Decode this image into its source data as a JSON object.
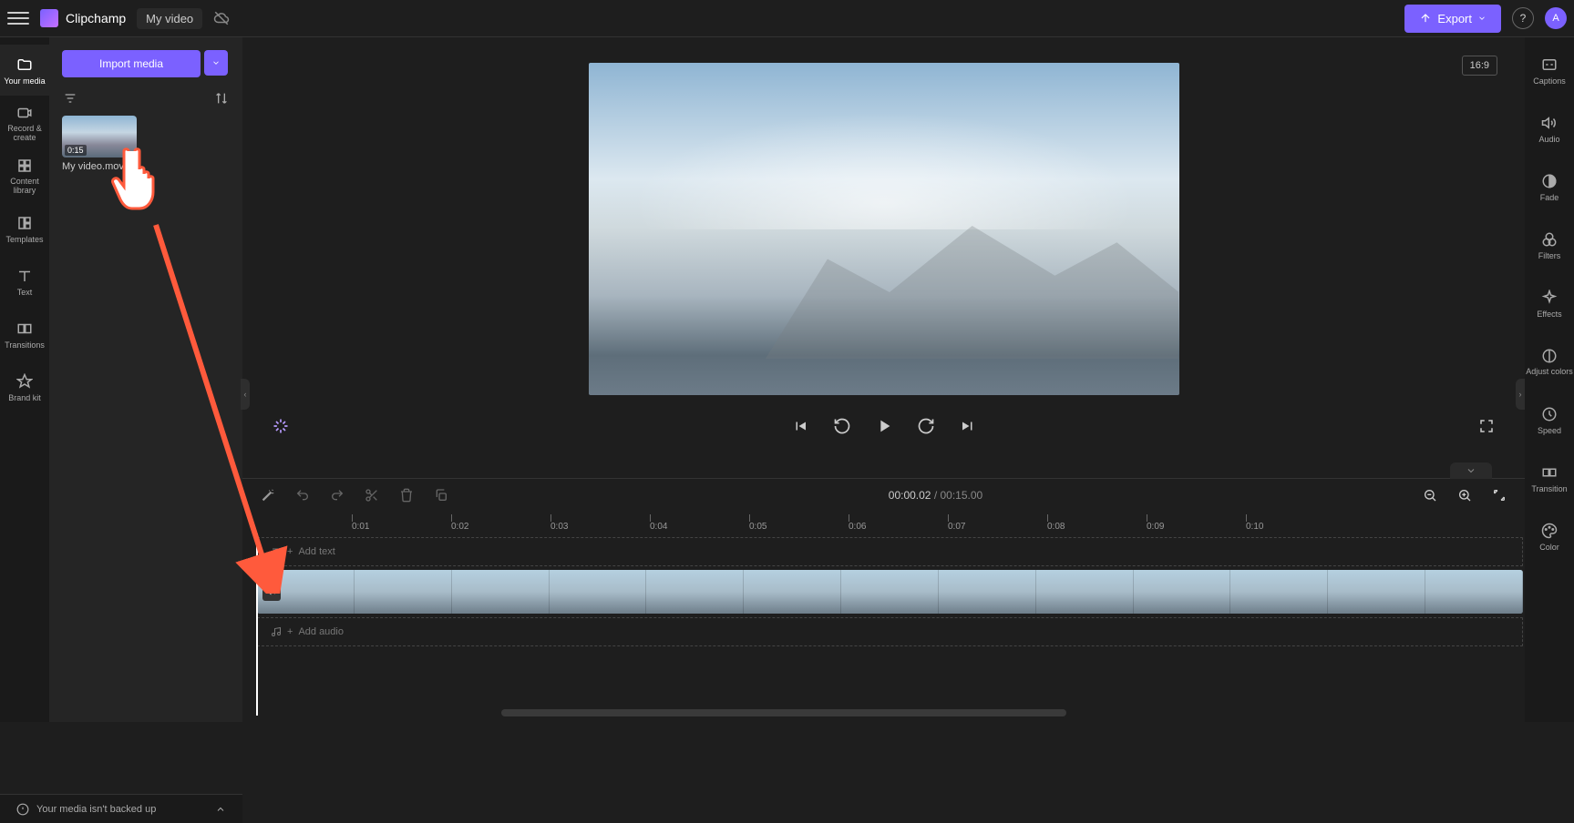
{
  "header": {
    "app_name": "Clipchamp",
    "video_title": "My video",
    "export_label": "Export",
    "avatar_letter": "A"
  },
  "left_nav": {
    "items": [
      {
        "label": "Your media",
        "icon": "folder"
      },
      {
        "label": "Record & create",
        "icon": "camera"
      },
      {
        "label": "Content library",
        "icon": "library"
      },
      {
        "label": "Templates",
        "icon": "templates"
      },
      {
        "label": "Text",
        "icon": "text"
      },
      {
        "label": "Transitions",
        "icon": "transitions"
      },
      {
        "label": "Brand kit",
        "icon": "brand"
      }
    ]
  },
  "media_panel": {
    "import_label": "Import media",
    "items": [
      {
        "duration": "0:15",
        "name": "My video.mov"
      }
    ]
  },
  "preview": {
    "aspect": "16:9",
    "current_time": "00:00.02",
    "duration": "00:15.00"
  },
  "right_nav": {
    "items": [
      {
        "label": "Captions",
        "icon": "cc"
      },
      {
        "label": "Audio",
        "icon": "speaker"
      },
      {
        "label": "Fade",
        "icon": "fade"
      },
      {
        "label": "Filters",
        "icon": "filters"
      },
      {
        "label": "Effects",
        "icon": "effects"
      },
      {
        "label": "Adjust colors",
        "icon": "adjust"
      },
      {
        "label": "Speed",
        "icon": "speed"
      },
      {
        "label": "Transition",
        "icon": "transition"
      },
      {
        "label": "Color",
        "icon": "color"
      }
    ]
  },
  "timeline": {
    "ruler_marks": [
      "0:01",
      "0:02",
      "0:03",
      "0:04",
      "0:05",
      "0:06",
      "0:07",
      "0:08",
      "0:09",
      "0:10"
    ],
    "add_text_label": "Add text",
    "add_audio_label": "Add audio"
  },
  "footer": {
    "backup_msg": "Your media isn't backed up"
  }
}
